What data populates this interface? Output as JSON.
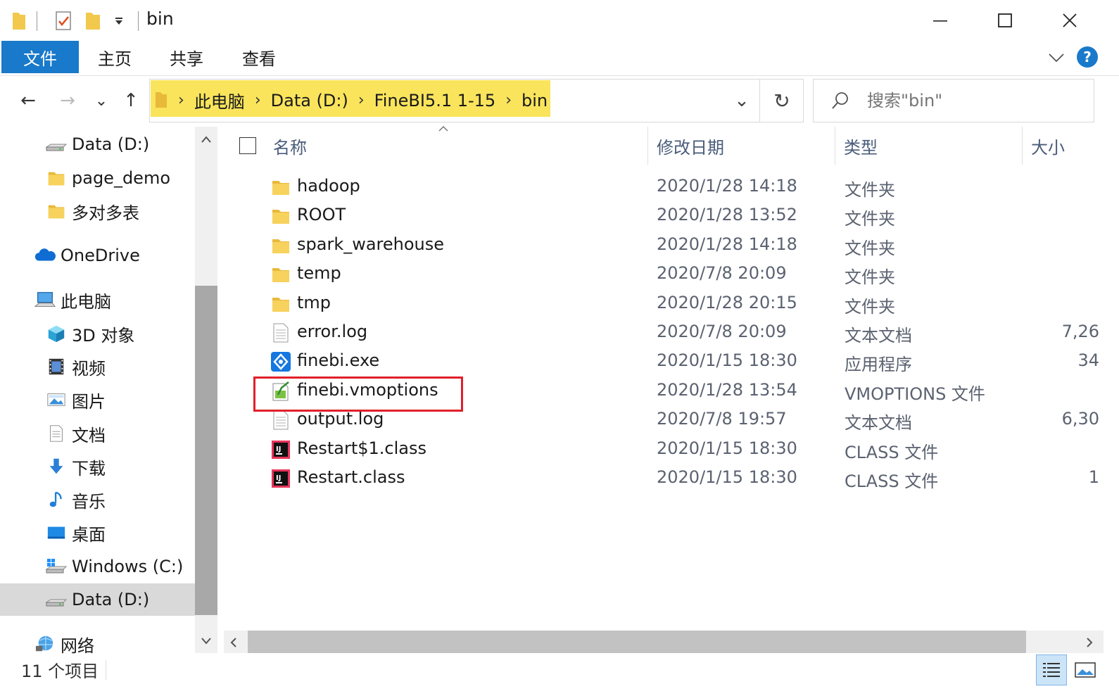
{
  "window": {
    "title": "bin",
    "minimize_glyph": "—",
    "maximize_glyph": "☐",
    "close_glyph": "✕"
  },
  "ribbon": {
    "tabs": [
      "文件",
      "主页",
      "共享",
      "查看"
    ],
    "active_tab": 0,
    "help_glyph": "?"
  },
  "address": {
    "crumbs": [
      "此电脑",
      "Data (D:)",
      "FineBI5.1 1-15",
      "bin"
    ],
    "separator": "›",
    "dropdown_glyph": "⌄",
    "refresh_glyph": "↻"
  },
  "search": {
    "placeholder": "搜索\"bin\""
  },
  "nav": {
    "back_glyph": "←",
    "forward_glyph": "→",
    "recent_glyph": "⌄",
    "up_glyph": "↑",
    "items": [
      {
        "label": "Data (D:)",
        "icon": "drive-icon",
        "indent": 1
      },
      {
        "label": "page_demo",
        "icon": "folder-icon",
        "indent": 1
      },
      {
        "label": "多对多表",
        "icon": "folder-icon",
        "indent": 1
      },
      {
        "label": "OneDrive",
        "icon": "cloud-icon",
        "indent": 0
      },
      {
        "label": "此电脑",
        "icon": "computer-icon",
        "indent": 0
      },
      {
        "label": "3D 对象",
        "icon": "cube-icon",
        "indent": 1
      },
      {
        "label": "视频",
        "icon": "video-icon",
        "indent": 1
      },
      {
        "label": "图片",
        "icon": "picture-icon",
        "indent": 1
      },
      {
        "label": "文档",
        "icon": "document-icon",
        "indent": 1
      },
      {
        "label": "下载",
        "icon": "download-icon",
        "indent": 1
      },
      {
        "label": "音乐",
        "icon": "music-icon",
        "indent": 1
      },
      {
        "label": "桌面",
        "icon": "desktop-icon",
        "indent": 1
      },
      {
        "label": "Windows (C:)",
        "icon": "windows-drive-icon",
        "indent": 1
      },
      {
        "label": "Data (D:)",
        "icon": "drive-icon",
        "indent": 1,
        "selected": true
      },
      {
        "label": "网络",
        "icon": "network-icon",
        "indent": 0
      }
    ]
  },
  "columns": {
    "name": "名称",
    "date": "修改日期",
    "type": "类型",
    "size": "大小"
  },
  "files": [
    {
      "name": "hadoop",
      "date": "2020/1/28 14:18",
      "type": "文件夹",
      "size": "",
      "icon": "folder-icon"
    },
    {
      "name": "ROOT",
      "date": "2020/1/28 13:52",
      "type": "文件夹",
      "size": "",
      "icon": "folder-icon"
    },
    {
      "name": "spark_warehouse",
      "date": "2020/1/28 14:18",
      "type": "文件夹",
      "size": "",
      "icon": "folder-icon"
    },
    {
      "name": "temp",
      "date": "2020/7/8 20:09",
      "type": "文件夹",
      "size": "",
      "icon": "folder-icon"
    },
    {
      "name": "tmp",
      "date": "2020/1/28 20:15",
      "type": "文件夹",
      "size": "",
      "icon": "folder-icon"
    },
    {
      "name": "error.log",
      "date": "2020/7/8 20:09",
      "type": "文本文档",
      "size": "7,26",
      "icon": "text-file-icon"
    },
    {
      "name": "finebi.exe",
      "date": "2020/1/15 18:30",
      "type": "应用程序",
      "size": "34",
      "icon": "finebi-app-icon"
    },
    {
      "name": "finebi.vmoptions",
      "date": "2020/1/28 13:54",
      "type": "VMOPTIONS 文件",
      "size": "",
      "icon": "vmoptions-file-icon"
    },
    {
      "name": "output.log",
      "date": "2020/7/8 19:57",
      "type": "文本文档",
      "size": "6,30",
      "icon": "text-file-icon"
    },
    {
      "name": "Restart$1.class",
      "date": "2020/1/15 18:30",
      "type": "CLASS 文件",
      "size": "",
      "icon": "intellij-class-icon"
    },
    {
      "name": "Restart.class",
      "date": "2020/1/15 18:30",
      "type": "CLASS 文件",
      "size": "1",
      "icon": "intellij-class-icon"
    }
  ],
  "status": {
    "item_count": "11 个项目"
  },
  "colors": {
    "accent": "#1979ca",
    "breadcrumb_highlight": "#f9e45c",
    "annotation_box": "#e0202a",
    "folder": "#f2c94c"
  }
}
